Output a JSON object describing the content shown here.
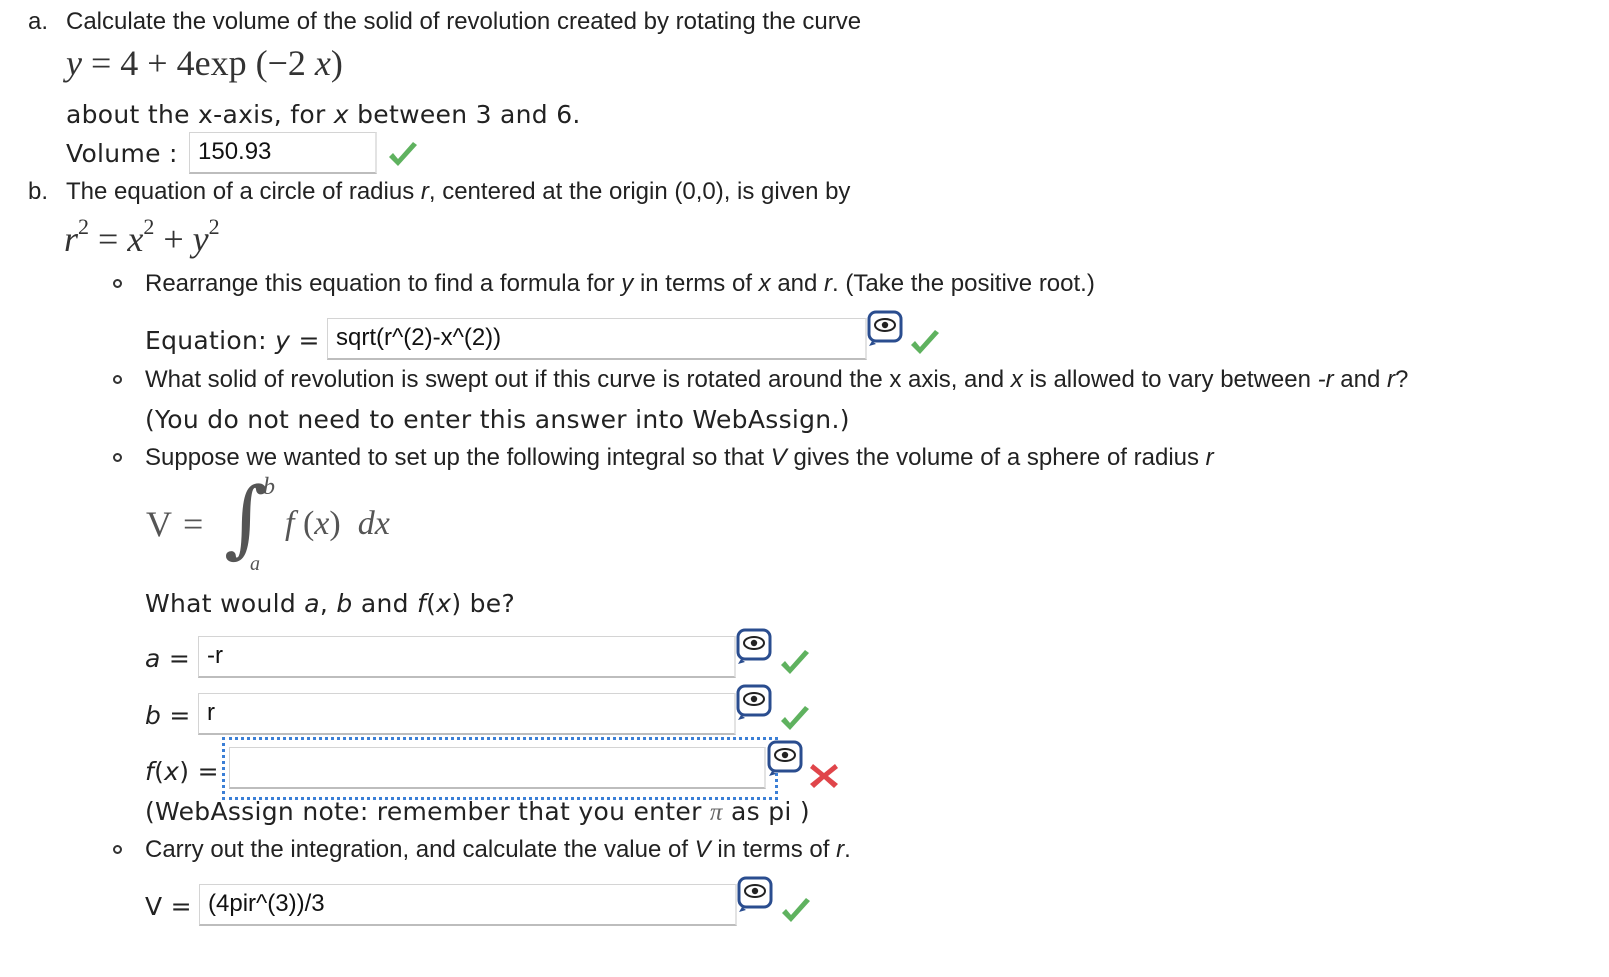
{
  "part_a": {
    "label": "a.",
    "intro": "Calculate the volume of the solid of revolution created by rotating the curve",
    "equation": {
      "y": "y",
      "eq": "=",
      "c1": "4",
      "plus": "+",
      "c2": "4",
      "fn": "exp",
      "open": "(",
      "neg": "−2",
      "x": "x",
      "close": ")"
    },
    "about_text_1": "about the x-axis, for",
    "about_var": "x",
    "about_text_2": "between 3 and 6.",
    "volume_label": "Volume :",
    "volume_value": "150.93",
    "volume_status": "correct"
  },
  "part_b": {
    "label": "b.",
    "intro_1": "The equation of a circle of radius",
    "intro_var": "r",
    "intro_2": ", centered at the origin (0,0), is given by",
    "circle_eq": {
      "r": "r",
      "x": "x",
      "y": "y",
      "exp": "2",
      "eq": "=",
      "plus": "+"
    },
    "items": {
      "rearrange": {
        "t1": "Rearrange this equation to find a formula for",
        "v1": "y",
        "t2": "in terms of",
        "v2": "x",
        "t3": "and",
        "v3": "r",
        "t4": ". (Take the positive root.)",
        "eq_label": "Equation:",
        "eq_var": "y",
        "eq_sign": "=",
        "value": "sqrt(r^(2)-x^(2))",
        "status": "correct"
      },
      "solid": {
        "t1": "What solid of revolution is swept out if this curve is rotated around the x axis, and",
        "v1": "x",
        "t2": "is allowed to vary between",
        "v2": "-r",
        "t3": "and",
        "v3": "r",
        "t4": "?",
        "note": "(You do not need to enter this answer into WebAssign.)"
      },
      "integral_setup": {
        "t1": "Suppose we wanted to set up the following integral so that",
        "v1": "V",
        "t2": "gives the volume of a sphere of radius",
        "v2": "r",
        "integral": {
          "V": "V",
          "eq": "=",
          "sign": "∫",
          "upper": "b",
          "lower": "a",
          "f": "f",
          "open": "(",
          "x": "x",
          "close": ")",
          "d": "d",
          "dx": "x"
        },
        "question_1": "What would",
        "question_a": "a",
        "question_2": ",",
        "question_b": "b",
        "question_3": "and",
        "question_f": "f",
        "question_4": "(",
        "question_x": "x",
        "question_5": ") be?",
        "a_label": "a",
        "b_label": "b",
        "fx_label_f": "f",
        "fx_label_open": "(",
        "fx_label_x": "x",
        "fx_label_close": ")",
        "eq_sign": "=",
        "a_value": "-r",
        "b_value": "r",
        "fx_value": "",
        "a_status": "correct",
        "b_status": "correct",
        "fx_status": "incorrect",
        "note_1": "(WebAssign note: remember that you enter",
        "note_pi": "π",
        "note_2": "as pi )"
      },
      "integration": {
        "t1": "Carry out the integration, and calculate the value of",
        "v1": "V",
        "t2": "in terms of",
        "v2": "r",
        "t3": ".",
        "v_label": "V",
        "eq_sign": "=",
        "value": "(4pir^(3))/3",
        "status": "correct"
      }
    }
  },
  "icons": {
    "correct": "check-icon",
    "incorrect": "cross-icon",
    "preview": "eye-preview-icon"
  },
  "colors": {
    "check": "#5fb25f",
    "cross": "#e0454a",
    "focus": "#3b7fd6",
    "preview_icon": "#2a4d8f"
  }
}
